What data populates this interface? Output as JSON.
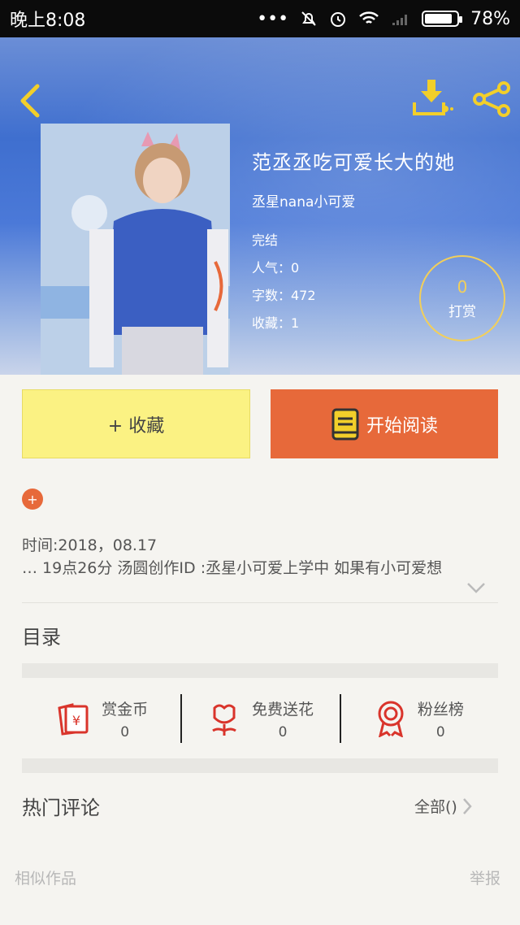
{
  "status_bar": {
    "time": "晚上8:08",
    "dots": "•••",
    "battery": "78%",
    "battery_level": 0.78
  },
  "book": {
    "title": "范丞丞吃可爱长大的她",
    "author": "丞星nana小可爱",
    "status": "完结",
    "popularity": "人气：0",
    "word_count": "字数：472",
    "favorites": "收藏：1"
  },
  "tip": {
    "count": "0",
    "label": "打赏"
  },
  "actions": {
    "favorite_label": "+ 收藏",
    "read_label": "开始阅读"
  },
  "intro": {
    "plus": "+",
    "line1": "时间:2018，08.17",
    "line2": "… 19点26分   汤圆创作ID :丞星小可爱上学中 如果有小可爱想"
  },
  "toc_label": "目录",
  "stats": [
    {
      "label": "赏金币",
      "value": "0"
    },
    {
      "label": "免费送花",
      "value": "0"
    },
    {
      "label": "粉丝榜",
      "value": "0"
    }
  ],
  "comments": {
    "title": "热门评论",
    "all_label": "全部()"
  },
  "footer": {
    "similar": "相似作品",
    "report": "举报"
  },
  "colors": {
    "accent_orange": "#e7693a",
    "fav_yellow": "#fbf283",
    "icon_red": "#d9342b",
    "tip_gold": "#f2cf5a"
  }
}
